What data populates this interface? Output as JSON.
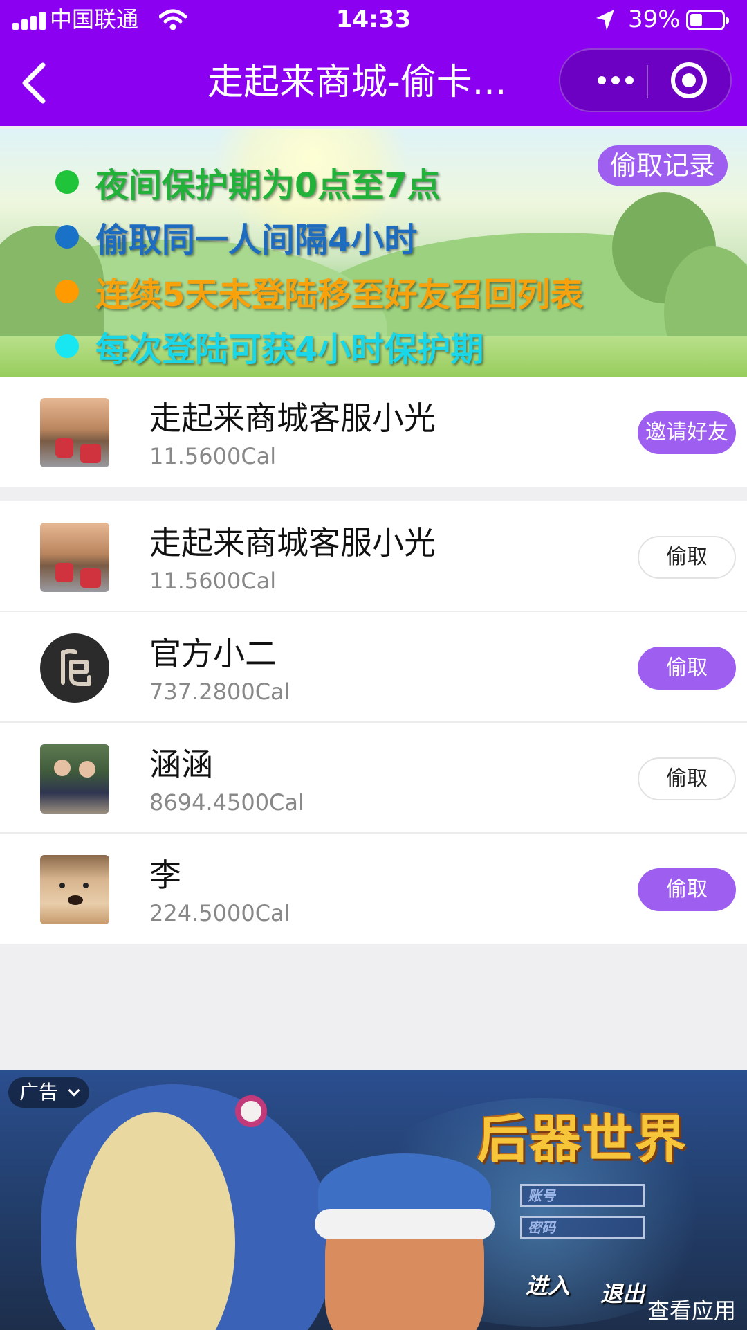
{
  "status_bar": {
    "carrier": "中国联通",
    "time": "14:33",
    "battery": "39%",
    "battery_level": 0.39
  },
  "nav": {
    "title": "走起来商城-偷卡...",
    "back_icon": "chevron-left-icon",
    "more_icon": "more-dots-icon",
    "close_icon": "target-close-icon"
  },
  "banner": {
    "record_button": "偷取记录",
    "rules": [
      {
        "text": "夜间保护期为0点至7点",
        "dot_color": "#1fc43a",
        "text_color": "#22b23a"
      },
      {
        "text": "偷取同一人间隔4小时",
        "dot_color": "#1a72c8",
        "text_color": "#1d6cc0"
      },
      {
        "text": "连续5天未登陆移至好友召回列表",
        "dot_color": "#ff9a00",
        "text_color": "#f7a20c"
      },
      {
        "text": "每次登陆可获4小时保护期",
        "dot_color": "#18e6f0",
        "text_color": "#19d6e8"
      }
    ]
  },
  "me": {
    "name": "走起来商城客服小光",
    "cal": "11.5600Cal",
    "action": "邀请好友"
  },
  "friends": [
    {
      "name": "走起来商城客服小光",
      "cal": "11.5600Cal",
      "action": "偷取",
      "style": "outline"
    },
    {
      "name": "官方小二",
      "cal": "737.2800Cal",
      "action": "偷取",
      "style": "filled",
      "logo_text": "币"
    },
    {
      "name": "涵涵",
      "cal": "8694.4500Cal",
      "action": "偷取",
      "style": "outline"
    },
    {
      "name": "李",
      "cal": "224.5000Cal",
      "action": "偷取",
      "style": "filled"
    }
  ],
  "ad": {
    "tag": "广告",
    "game_logo": "后器世界",
    "account_placeholder": "账号",
    "password_placeholder": "密码",
    "enter": "进入",
    "exit": "退出",
    "view_app": "查看应用"
  },
  "colors": {
    "brand_purple": "#8b00f0",
    "button_purple": "#9e5ef0",
    "background": "#efeff1"
  }
}
